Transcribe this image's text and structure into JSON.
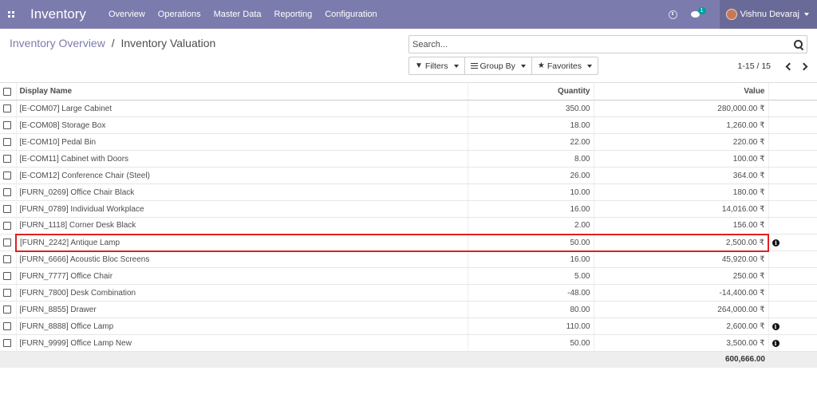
{
  "navbar": {
    "app_title": "Inventory",
    "menu": [
      "Overview",
      "Operations",
      "Master Data",
      "Reporting",
      "Configuration"
    ],
    "chat_badge": "1",
    "user_name": "Vishnu Devaraj",
    "color": "#7c7bad"
  },
  "breadcrumb": {
    "parent": "Inventory Overview",
    "separator": "/",
    "current": "Inventory Valuation"
  },
  "search": {
    "placeholder": "Search..."
  },
  "filters": {
    "filters_label": "Filters",
    "group_by_label": "Group By",
    "favorites_label": "Favorites"
  },
  "pager": {
    "value": "1-15 / 15"
  },
  "table": {
    "headers": {
      "name": "Display Name",
      "quantity": "Quantity",
      "value": "Value"
    },
    "rows": [
      {
        "name": "[E-COM07] Large Cabinet",
        "quantity": "350.00",
        "value": "280,000.00 ₹",
        "info": false
      },
      {
        "name": "[E-COM08] Storage Box",
        "quantity": "18.00",
        "value": "1,260.00 ₹",
        "info": false
      },
      {
        "name": "[E-COM10] Pedal Bin",
        "quantity": "22.00",
        "value": "220.00 ₹",
        "info": false
      },
      {
        "name": "[E-COM11] Cabinet with Doors",
        "quantity": "8.00",
        "value": "100.00 ₹",
        "info": false
      },
      {
        "name": "[E-COM12] Conference Chair (Steel)",
        "quantity": "26.00",
        "value": "364.00 ₹",
        "info": false
      },
      {
        "name": "[FURN_0269] Office Chair Black",
        "quantity": "10.00",
        "value": "180.00 ₹",
        "info": false
      },
      {
        "name": "[FURN_0789] Individual Workplace",
        "quantity": "16.00",
        "value": "14,016.00 ₹",
        "info": false
      },
      {
        "name": "[FURN_1118] Corner Desk Black",
        "quantity": "2.00",
        "value": "156.00 ₹",
        "info": false
      },
      {
        "name": "[FURN_2242] Antique Lamp",
        "quantity": "50.00",
        "value": "2,500.00 ₹",
        "info": true,
        "highlight": true
      },
      {
        "name": "[FURN_6666] Acoustic Bloc Screens",
        "quantity": "16.00",
        "value": "45,920.00 ₹",
        "info": false
      },
      {
        "name": "[FURN_7777] Office Chair",
        "quantity": "5.00",
        "value": "250.00 ₹",
        "info": false
      },
      {
        "name": "[FURN_7800] Desk Combination",
        "quantity": "-48.00",
        "value": "-14,400.00 ₹",
        "info": false
      },
      {
        "name": "[FURN_8855] Drawer",
        "quantity": "80.00",
        "value": "264,000.00 ₹",
        "info": false
      },
      {
        "name": "[FURN_8888] Office Lamp",
        "quantity": "110.00",
        "value": "2,600.00 ₹",
        "info": true
      },
      {
        "name": "[FURN_9999] Office Lamp New",
        "quantity": "50.00",
        "value": "3,500.00 ₹",
        "info": true
      }
    ],
    "total_value": "600,666.00",
    "info_icon_glyph": "i"
  }
}
